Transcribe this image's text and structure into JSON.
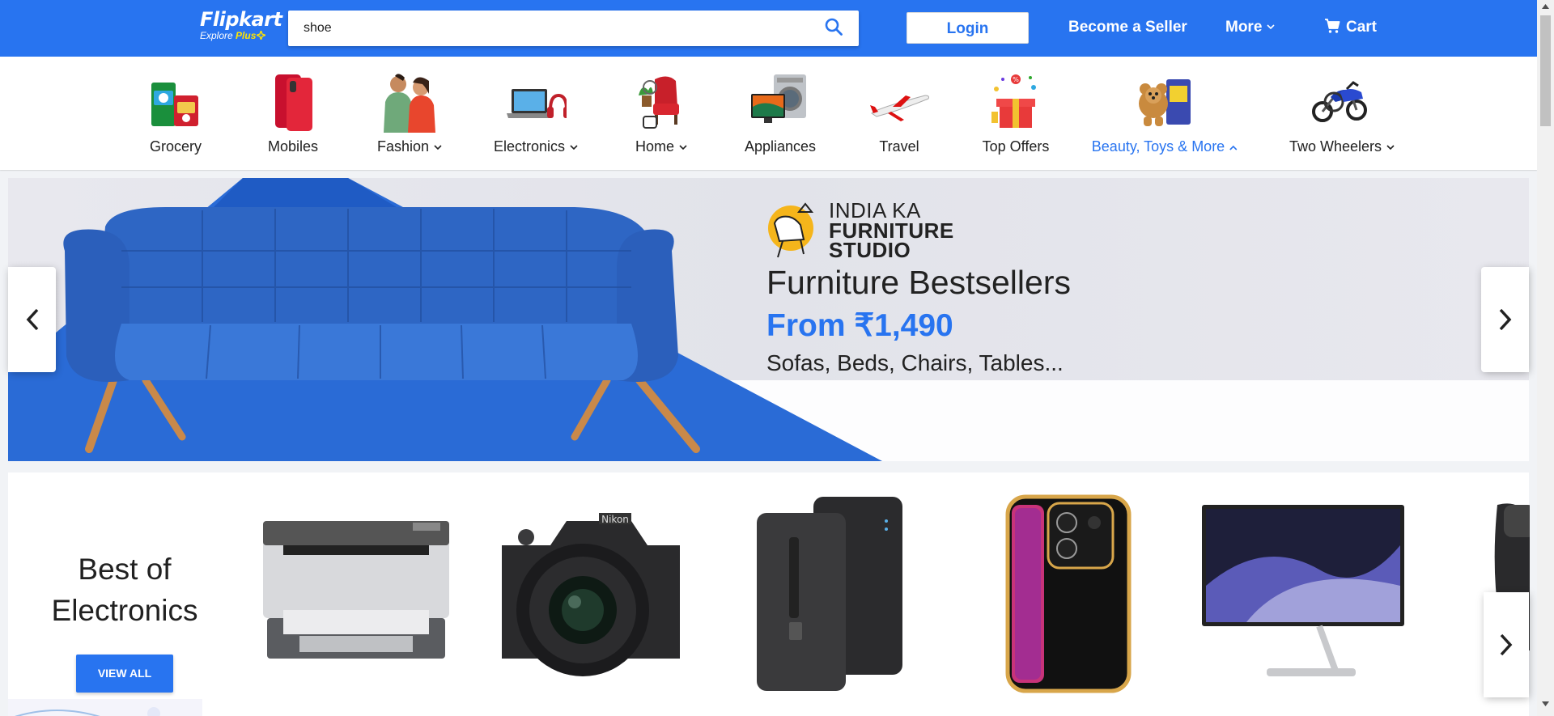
{
  "header": {
    "logo_main": "Flipkart",
    "logo_sub": "Explore",
    "logo_plus": "Plus",
    "search_value": "shoe",
    "login_label": "Login",
    "become_seller_label": "Become a Seller",
    "more_label": "More",
    "cart_label": "Cart",
    "colors": {
      "brand": "#2874f0",
      "plus": "#ffe500"
    }
  },
  "categories": [
    {
      "label": "Grocery",
      "icon": "grocery-icon",
      "dropdown": false
    },
    {
      "label": "Mobiles",
      "icon": "mobiles-icon",
      "dropdown": false
    },
    {
      "label": "Fashion",
      "icon": "fashion-icon",
      "dropdown": true
    },
    {
      "label": "Electronics",
      "icon": "electronics-icon",
      "dropdown": true
    },
    {
      "label": "Home",
      "icon": "home-icon",
      "dropdown": true
    },
    {
      "label": "Appliances",
      "icon": "appliances-icon",
      "dropdown": false
    },
    {
      "label": "Travel",
      "icon": "travel-icon",
      "dropdown": false
    },
    {
      "label": "Top Offers",
      "icon": "top-offers-icon",
      "dropdown": false
    },
    {
      "label": "Beauty, Toys & More",
      "icon": "beauty-toys-icon",
      "dropdown": true,
      "active": true
    },
    {
      "label": "Two Wheelers",
      "icon": "two-wheelers-icon",
      "dropdown": true
    }
  ],
  "banner": {
    "studio_line1": "INDIA KA",
    "studio_line2": "FURNITURE",
    "studio_line3": "STUDIO",
    "title": "Furniture Bestsellers",
    "price": "From ₹1,490",
    "subtitle": "Sofas, Beds, Chairs, Tables..."
  },
  "electronics_section": {
    "title_line1": "Best of",
    "title_line2": "Electronics",
    "view_all_label": "VIEW ALL",
    "products": [
      "printer-image",
      "camera-image",
      "power-bank-image",
      "phone-image",
      "monitor-image",
      "trimmer-image"
    ]
  }
}
